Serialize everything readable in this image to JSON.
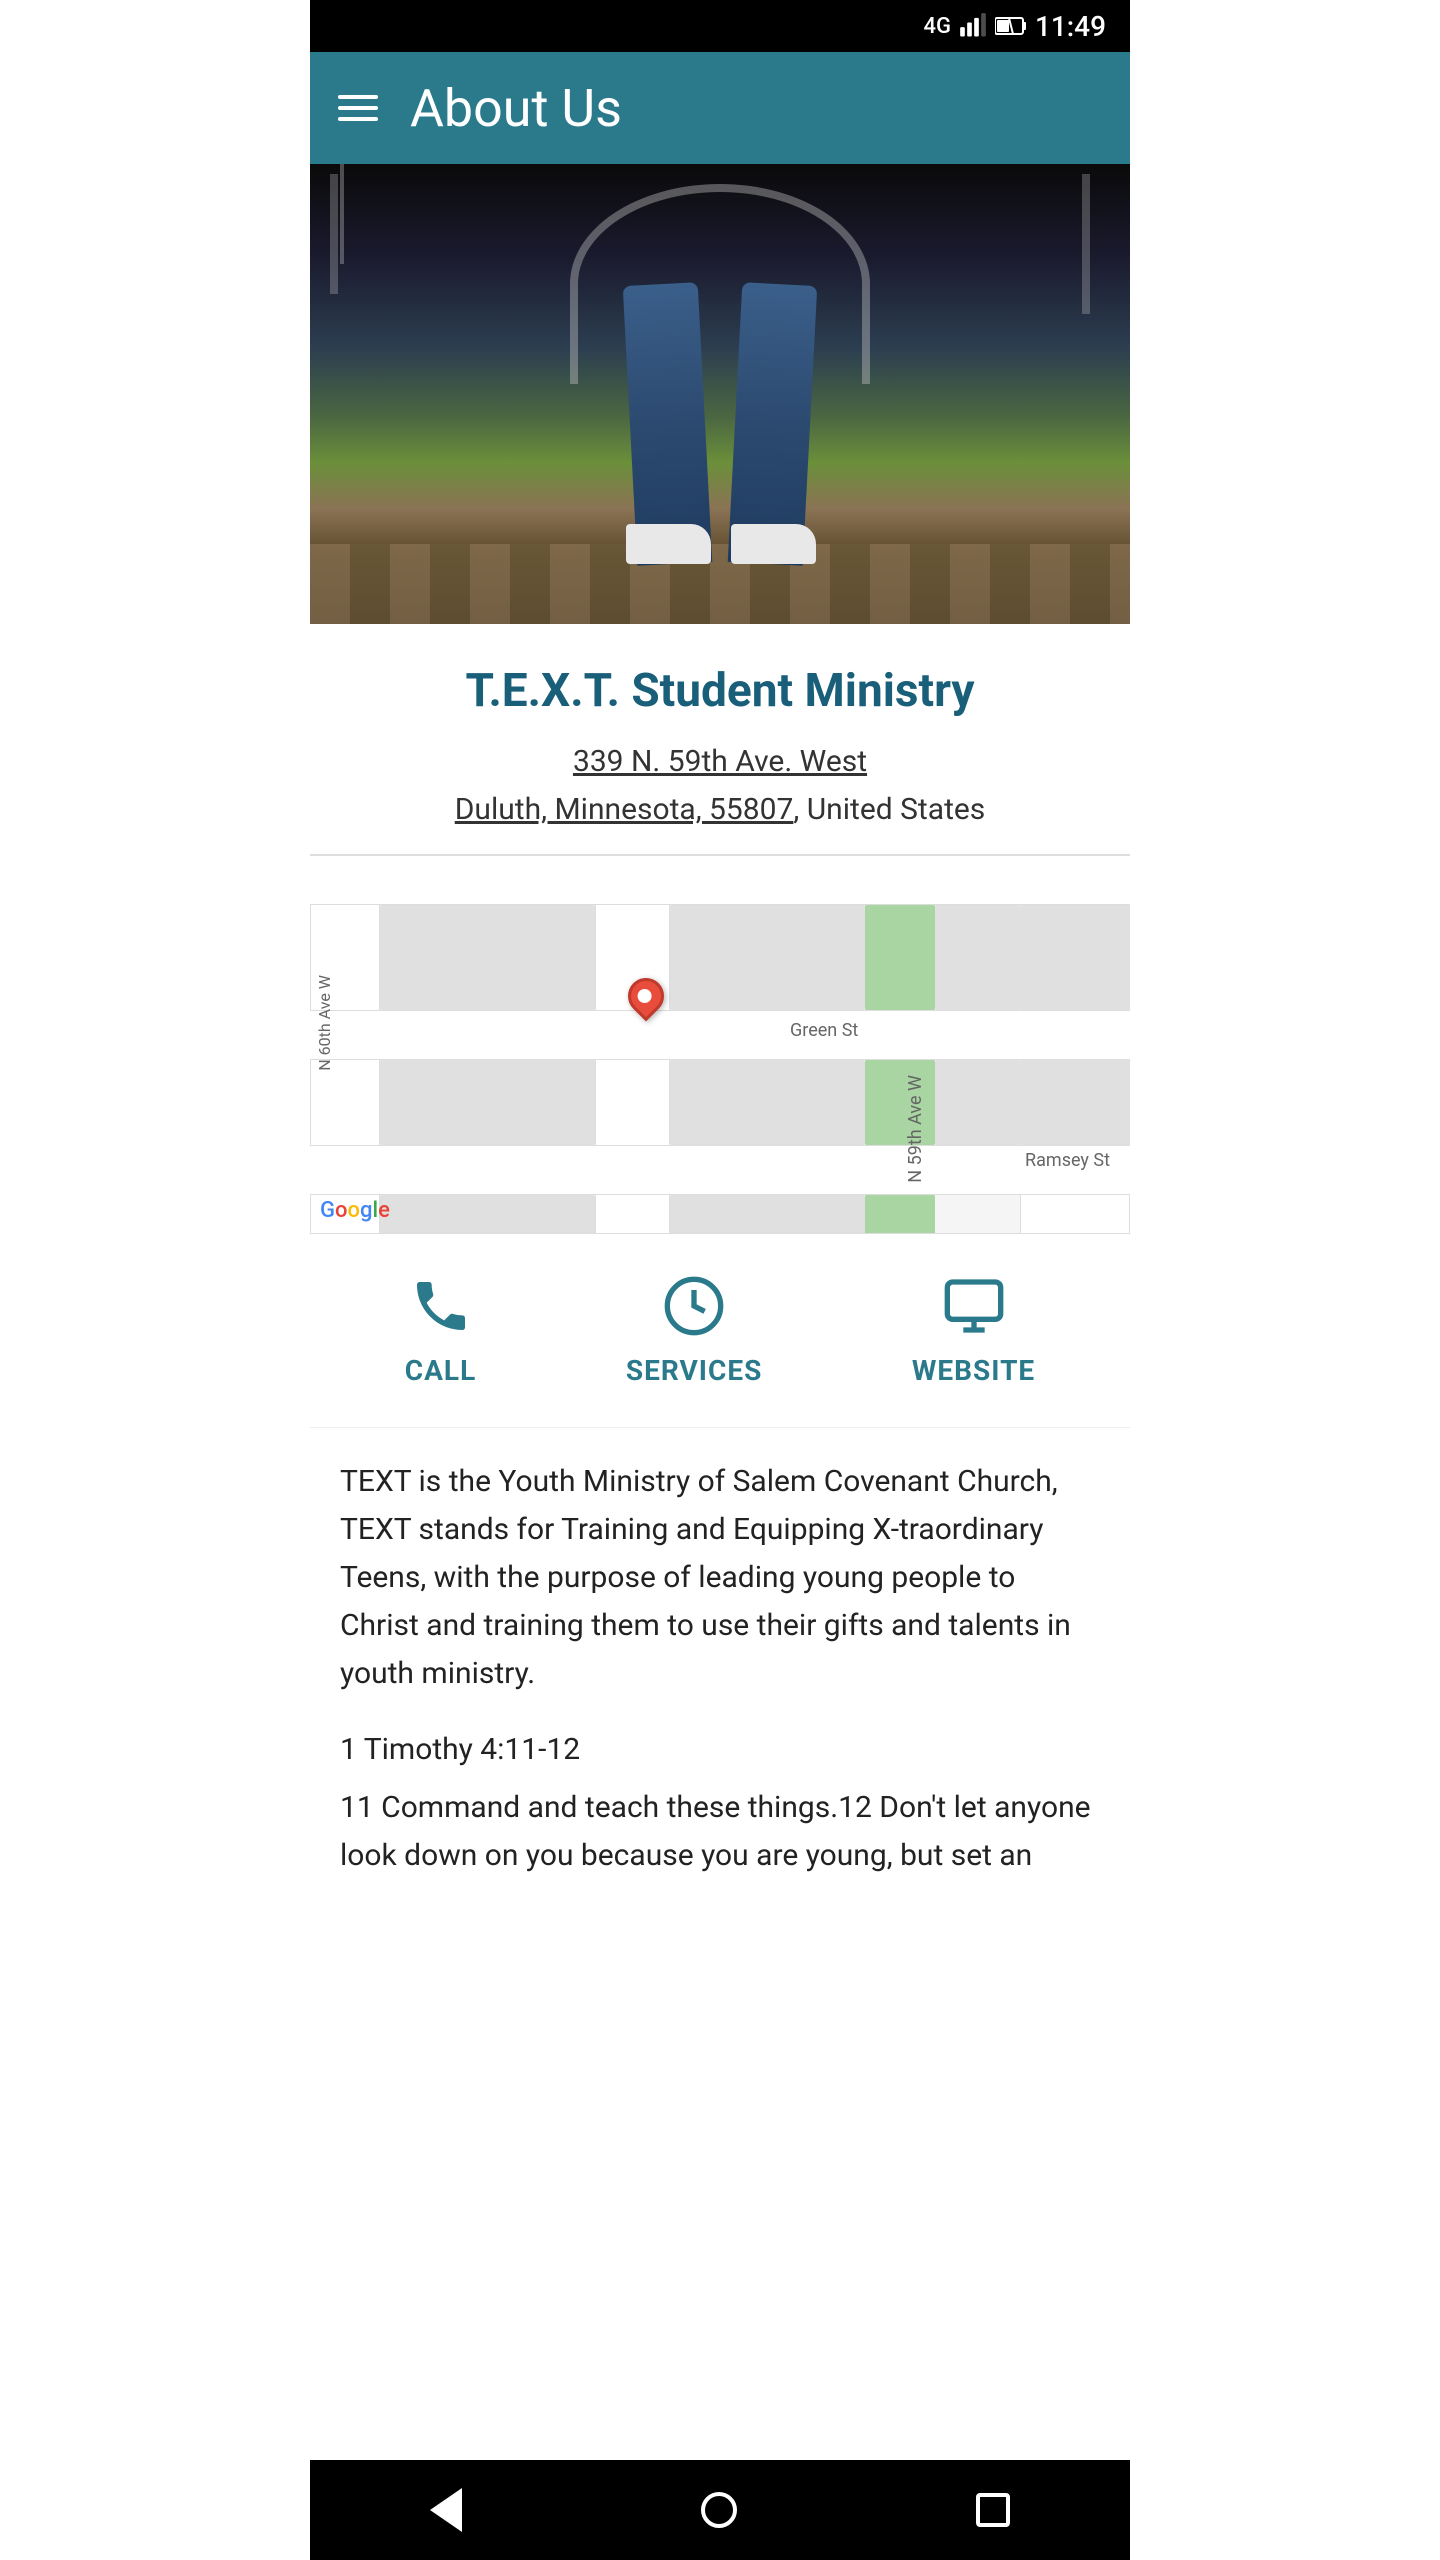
{
  "statusBar": {
    "network": "4G",
    "time": "11:49",
    "batteryIcon": "battery"
  },
  "appBar": {
    "menuIcon": "hamburger-menu",
    "title": "About Us"
  },
  "ministry": {
    "name": "T.E.X.T. Student Ministry",
    "addressLine1": "339 N. 59th Ave. West",
    "addressLine2": "Duluth, Minnesota, 55807",
    "addressCountry": ", United States"
  },
  "map": {
    "streetLabels": {
      "greenSt": "Green St",
      "n59thAveW": "N 59th Ave W",
      "n60thAveW": "N 60th Ave W",
      "ramseySt": "Ramsey St"
    },
    "googleLogo": "Google"
  },
  "actions": {
    "call": {
      "label": "CALL",
      "icon": "phone"
    },
    "services": {
      "label": "SERVICES",
      "icon": "clock"
    },
    "website": {
      "label": "WEBSITE",
      "icon": "monitor"
    }
  },
  "description": {
    "mainText": "TEXT is the Youth Ministry of Salem Covenant Church, TEXT stands for Training and Equipping X-traordinary Teens, with the purpose of leading young people to Christ and training them to use their gifts and talents in youth ministry.",
    "scriptureRef": "1 Timothy 4:11-12",
    "scriptureText": "11 Command and teach these things.12 Don't let anyone look down on you because you are young, but set an"
  },
  "bottomNav": {
    "backButton": "back",
    "homeButton": "home",
    "recentButton": "recent-apps"
  }
}
